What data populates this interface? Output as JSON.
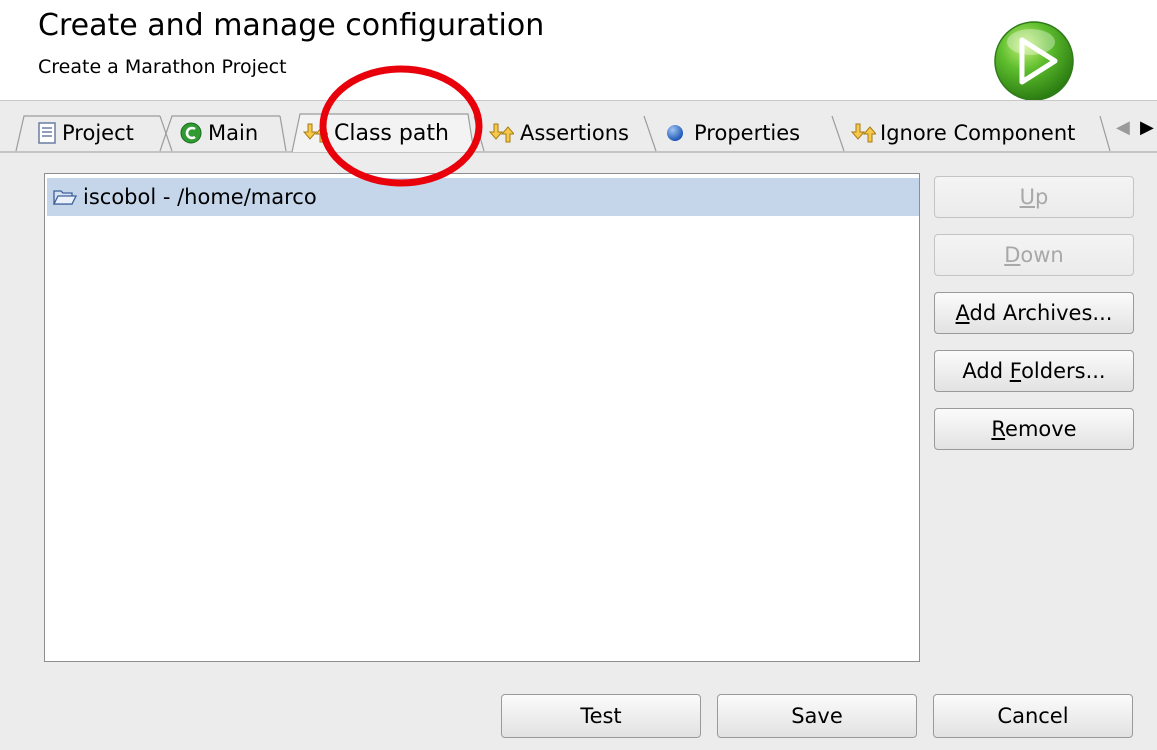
{
  "header": {
    "title": "Create and manage configuration",
    "subtitle": "Create a Marathon Project",
    "logo_icon": "play-circle-icon",
    "logo_color": "#3fae2a"
  },
  "tabs": [
    {
      "label": "Project",
      "icon": "document-icon",
      "active": false
    },
    {
      "label": "Main",
      "icon": "green-c-icon",
      "active": false
    },
    {
      "label": "Class path",
      "icon": "arrows-icon",
      "active": true
    },
    {
      "label": "Assertions",
      "icon": "arrows-icon",
      "active": false
    },
    {
      "label": "Properties",
      "icon": "blue-ball-icon",
      "active": false
    },
    {
      "label": "Ignore Component",
      "icon": "arrows-icon",
      "active": false
    }
  ],
  "classpath": {
    "entries": [
      {
        "label": "iscobol - /home/marco",
        "icon": "folder-open-icon",
        "selected": true
      }
    ]
  },
  "side_buttons": {
    "up": {
      "label": "Up",
      "mnemonic": "U",
      "enabled": false
    },
    "down": {
      "label": "Down",
      "mnemonic": "D",
      "enabled": false
    },
    "add_archives": {
      "label": "Add Archives...",
      "mnemonic": "A",
      "enabled": true
    },
    "add_folders": {
      "label": "Add Folders...",
      "mnemonic": "F",
      "enabled": true
    },
    "remove": {
      "label": "Remove",
      "mnemonic": "R",
      "enabled": true
    }
  },
  "footer_buttons": {
    "test": "Test",
    "save": "Save",
    "cancel": "Cancel"
  },
  "annotation": {
    "color": "#e8000b"
  },
  "colors": {
    "selection": "#c5d6ea",
    "panel": "#ececec"
  }
}
